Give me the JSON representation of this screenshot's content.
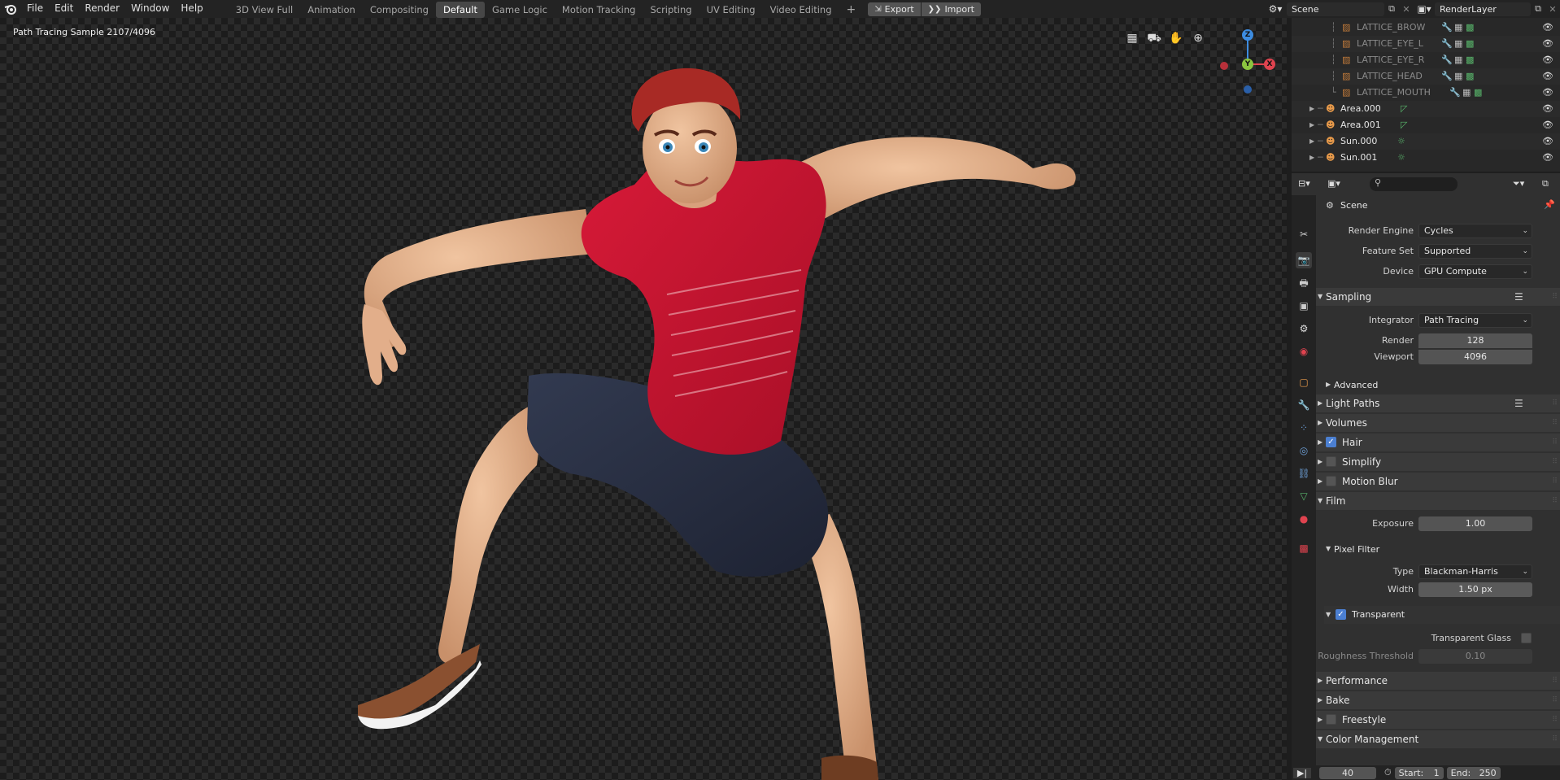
{
  "menu": {
    "logo_icon": "blender-logo-icon",
    "items": [
      "File",
      "Edit",
      "Render",
      "Window",
      "Help"
    ]
  },
  "workspaces": {
    "tabs": [
      "3D View Full",
      "Animation",
      "Compositing",
      "Default",
      "Game Logic",
      "Motion Tracking",
      "Scripting",
      "UV Editing",
      "Video Editing"
    ],
    "active": "Default",
    "add_label": "+",
    "export_label": "Export",
    "import_label": "Import"
  },
  "scene_selector": {
    "value": "Scene"
  },
  "view_layer": {
    "value": "RenderLayer"
  },
  "viewport": {
    "sample_text": "Path Tracing Sample 2107/4096",
    "gizmo": {
      "z": "Z",
      "y": "Y",
      "x": "X"
    }
  },
  "outliner": {
    "rows": [
      {
        "name": "LATTICE_BROW",
        "icon": "lattice-icon",
        "muted": true
      },
      {
        "name": "LATTICE_EYE_L",
        "icon": "lattice-icon",
        "muted": true
      },
      {
        "name": "LATTICE_EYE_R",
        "icon": "lattice-icon",
        "muted": true
      },
      {
        "name": "LATTICE_HEAD",
        "icon": "lattice-icon",
        "muted": true
      },
      {
        "name": "LATTICE_MOUTH",
        "icon": "lattice-icon",
        "muted": true
      },
      {
        "name": "Area.000",
        "icon": "light-icon",
        "muted": false
      },
      {
        "name": "Area.001",
        "icon": "light-icon",
        "muted": false
      },
      {
        "name": "Sun.000",
        "icon": "light-icon",
        "muted": false
      },
      {
        "name": "Sun.001",
        "icon": "light-icon",
        "muted": false
      }
    ]
  },
  "properties": {
    "context": "Scene",
    "render_engine": {
      "label": "Render Engine",
      "value": "Cycles"
    },
    "feature_set": {
      "label": "Feature Set",
      "value": "Supported"
    },
    "device": {
      "label": "Device",
      "value": "GPU Compute"
    },
    "sampling": {
      "title": "Sampling",
      "integrator": {
        "label": "Integrator",
        "value": "Path Tracing"
      },
      "render": {
        "label": "Render",
        "value": "128"
      },
      "viewport": {
        "label": "Viewport",
        "value": "4096"
      },
      "advanced": "Advanced"
    },
    "light_paths": "Light Paths",
    "volumes": "Volumes",
    "hair": {
      "label": "Hair",
      "checked": true
    },
    "simplify": {
      "label": "Simplify",
      "checked": false
    },
    "motion_blur": {
      "label": "Motion Blur",
      "checked": false
    },
    "film": {
      "title": "Film",
      "exposure": {
        "label": "Exposure",
        "value": "1.00"
      },
      "pixel_filter": "Pixel Filter",
      "type": {
        "label": "Type",
        "value": "Blackman-Harris"
      },
      "width": {
        "label": "Width",
        "value": "1.50 px"
      },
      "transparent": {
        "label": "Transparent",
        "checked": true
      },
      "transparent_glass": {
        "label": "Transparent Glass",
        "checked": false
      },
      "roughness": {
        "label": "Roughness Threshold",
        "value": "0.10"
      }
    },
    "performance": "Performance",
    "bake": "Bake",
    "freestyle": {
      "label": "Freestyle",
      "checked": false
    },
    "color_management": "Color Management"
  },
  "timeline": {
    "current_frame": "40",
    "start_label": "Start:",
    "start": "1",
    "end_label": "End:",
    "end": "250"
  },
  "colors": {
    "accent": "#4b7fd1",
    "gizmo_x": "#e0434f",
    "gizmo_y": "#8bc53f",
    "gizmo_z": "#3d8ce0",
    "shirt": "#c4122f",
    "skin": "#e3b08e",
    "shorts": "#2a3042"
  }
}
